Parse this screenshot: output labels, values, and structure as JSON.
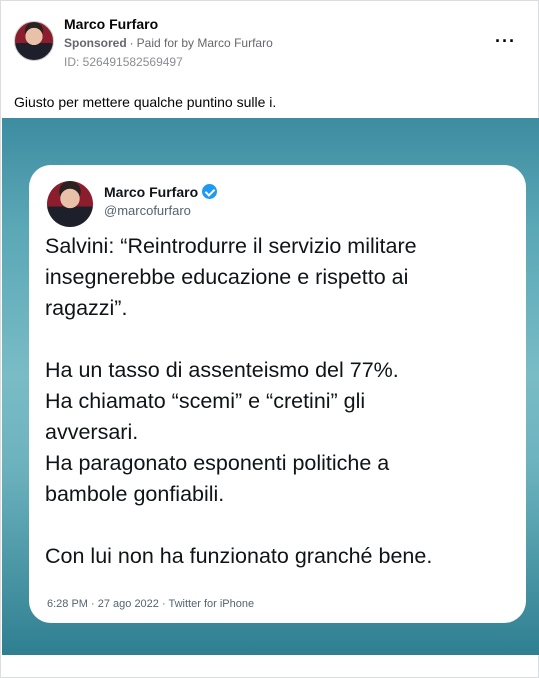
{
  "post": {
    "author": "Marco Furfaro",
    "sponsored": "Sponsored",
    "paid_for_prefix": "Paid for by",
    "paid_for_name": "Marco Furfaro",
    "ad_id": "ID: 526491582569497",
    "caption": "Giusto per mettere qualche puntino sulle i.",
    "more_label": "···"
  },
  "tweet": {
    "name": "Marco Furfaro",
    "handle": "@marcofurfaro",
    "lines": [
      "Salvini: “Reintrodurre il servizio militare",
      "insegnerebbe educazione e rispetto ai",
      "ragazzi”.",
      "",
      "Ha un tasso di assenteismo del 77%.",
      "Ha chiamato “scemi” e “cretini” gli",
      "avversari.",
      "Ha paragonato esponenti politiche a",
      "bambole gonfiabili.",
      "",
      "Con lui non ha funzionato granché bene."
    ],
    "meta": "6:28 PM · 27 ago 2022 · Twitter for iPhone"
  }
}
